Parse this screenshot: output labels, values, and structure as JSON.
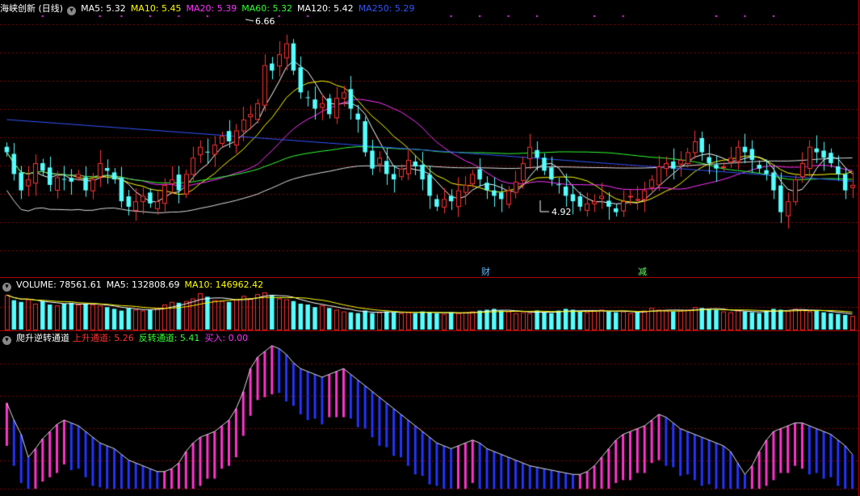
{
  "main_panel": {
    "title": "海峡创新 (日线)",
    "ma_labels": [
      {
        "text": "MA5: 5.32",
        "color": "#ffffff"
      },
      {
        "text": "MA10: 5.45",
        "color": "#ffff00"
      },
      {
        "text": "MA20: 5.39",
        "color": "#ff33ff"
      },
      {
        "text": "MA60: 5.32",
        "color": "#33ff33"
      },
      {
        "text": "MA120: 5.42",
        "color": "#ffffff"
      },
      {
        "text": "MA250: 5.29",
        "color": "#3355ff"
      }
    ],
    "high_label": "6.66",
    "low_label": "4.92",
    "event_tags": [
      {
        "text": "财",
        "color": "#66bbff"
      },
      {
        "text": "减",
        "color": "#66ff66"
      }
    ]
  },
  "volume_panel": {
    "labels": [
      {
        "text": "VOLUME: 78561.61",
        "color": "#ffffff"
      },
      {
        "text": "MA5: 132808.69",
        "color": "#ffffff"
      },
      {
        "text": "MA10: 146962.42",
        "color": "#ffff00"
      }
    ]
  },
  "indicator_panel": {
    "title": "爬升逆转通道",
    "labels": [
      {
        "text": "上升通道: 5.26",
        "color": "#ff3333"
      },
      {
        "text": "反转通道: 5.41",
        "color": "#33ff33"
      },
      {
        "text": "买入: 0.00",
        "color": "#ff33ff"
      }
    ]
  },
  "colors": {
    "up": "#ff3232",
    "down": "#54ffff",
    "grid": "#8b0000",
    "ind_up": "#ff33cc",
    "ind_down": "#2233ff"
  },
  "chart_data": {
    "type": "candlestick",
    "price_range": [
      4.5,
      6.8
    ],
    "closes": [
      5.55,
      5.35,
      5.2,
      5.3,
      5.45,
      5.38,
      5.25,
      5.32,
      5.3,
      5.28,
      5.35,
      5.2,
      5.3,
      5.45,
      5.38,
      5.3,
      5.1,
      5.05,
      5.1,
      5.15,
      5.08,
      5.1,
      5.25,
      5.3,
      5.2,
      5.35,
      5.5,
      5.6,
      5.55,
      5.62,
      5.7,
      5.65,
      5.75,
      5.85,
      5.9,
      6.0,
      6.35,
      6.3,
      6.45,
      6.55,
      6.3,
      6.1,
      6.05,
      5.95,
      6.0,
      5.9,
      6.05,
      6.1,
      5.95,
      5.85,
      5.55,
      5.4,
      5.5,
      5.35,
      5.3,
      5.4,
      5.48,
      5.42,
      5.3,
      5.15,
      5.05,
      5.12,
      5.1,
      5.2,
      5.25,
      5.35,
      5.3,
      5.2,
      5.15,
      5.12,
      5.2,
      5.28,
      5.45,
      5.6,
      5.5,
      5.38,
      5.3,
      5.25,
      5.15,
      5.1,
      5.05,
      5.08,
      5.1,
      5.15,
      5.05,
      5.0,
      5.1,
      5.15,
      5.12,
      5.2,
      5.3,
      5.42,
      5.45,
      5.4,
      5.48,
      5.55,
      5.65,
      5.55,
      5.45,
      5.4,
      5.42,
      5.5,
      5.6,
      5.55,
      5.48,
      5.4,
      5.35,
      5.2,
      5.0,
      5.1,
      5.3,
      5.45,
      5.6,
      5.55,
      5.5,
      5.45,
      5.35,
      5.2,
      5.25
    ],
    "volumes": [
      200000,
      170000,
      160000,
      175000,
      150000,
      165000,
      145000,
      140000,
      150000,
      155000,
      145000,
      150000,
      145000,
      140000,
      130000,
      120000,
      110000,
      125000,
      115000,
      110000,
      115000,
      120000,
      145000,
      160000,
      155000,
      165000,
      180000,
      210000,
      190000,
      170000,
      165000,
      160000,
      175000,
      195000,
      180000,
      205000,
      215000,
      200000,
      180000,
      175000,
      165000,
      150000,
      145000,
      130000,
      140000,
      125000,
      115000,
      105000,
      100000,
      95000,
      110000,
      95000,
      100000,
      105000,
      100000,
      95000,
      100000,
      95000,
      105000,
      100000,
      95000,
      90000,
      100000,
      95000,
      100000,
      105000,
      110000,
      115000,
      120000,
      110000,
      105000,
      95000,
      100000,
      95000,
      110000,
      100000,
      95000,
      110000,
      120000,
      115000,
      105000,
      100000,
      110000,
      115000,
      105000,
      100000,
      105000,
      95000,
      100000,
      110000,
      125000,
      115000,
      110000,
      105000,
      110000,
      115000,
      130000,
      125000,
      120000,
      115000,
      105000,
      100000,
      110000,
      105000,
      100000,
      95000,
      110000,
      120000,
      115000,
      110000,
      120000,
      115000,
      105000,
      110000,
      100000,
      95000,
      90000,
      85000,
      78562
    ],
    "indicator": [
      0.6,
      0.48,
      0.38,
      0.22,
      0.28,
      0.35,
      0.4,
      0.45,
      0.48,
      0.46,
      0.44,
      0.4,
      0.36,
      0.32,
      0.3,
      0.28,
      0.24,
      0.2,
      0.18,
      0.16,
      0.14,
      0.12,
      0.12,
      0.14,
      0.18,
      0.26,
      0.32,
      0.36,
      0.38,
      0.4,
      0.44,
      0.48,
      0.56,
      0.68,
      0.84,
      0.92,
      0.96,
      1.0,
      0.98,
      0.94,
      0.88,
      0.84,
      0.82,
      0.8,
      0.78,
      0.8,
      0.82,
      0.84,
      0.8,
      0.76,
      0.72,
      0.68,
      0.64,
      0.6,
      0.56,
      0.52,
      0.48,
      0.44,
      0.4,
      0.36,
      0.32,
      0.3,
      0.28,
      0.3,
      0.32,
      0.34,
      0.32,
      0.28,
      0.26,
      0.24,
      0.22,
      0.2,
      0.18,
      0.16,
      0.15,
      0.14,
      0.13,
      0.12,
      0.11,
      0.1,
      0.1,
      0.12,
      0.16,
      0.22,
      0.28,
      0.34,
      0.38,
      0.4,
      0.42,
      0.44,
      0.48,
      0.52,
      0.5,
      0.46,
      0.42,
      0.4,
      0.38,
      0.36,
      0.34,
      0.32,
      0.3,
      0.26,
      0.18,
      0.1,
      0.16,
      0.26,
      0.34,
      0.4,
      0.42,
      0.44,
      0.46,
      0.46,
      0.44,
      0.42,
      0.4,
      0.38,
      0.34,
      0.3,
      0.24
    ]
  }
}
